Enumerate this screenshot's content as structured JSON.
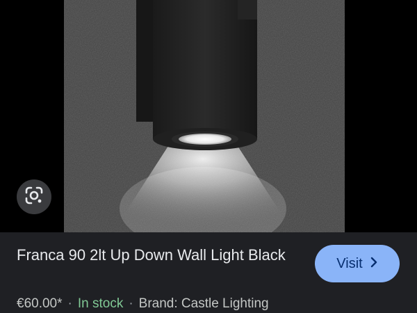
{
  "product": {
    "title": "Franca 90 2lt Up Down Wall Light Black",
    "price": "€60.00*",
    "stock": "In stock",
    "brand": "Brand: Castle Lighting",
    "separator": "·"
  },
  "actions": {
    "visit_label": "Visit"
  },
  "icons": {
    "lens": "google-lens-icon",
    "visit_chevron": "chevron-right-icon"
  },
  "colors": {
    "panel_background": "#1f2024",
    "visit_button": "#8ab4f8",
    "visit_text": "#062e6f",
    "stock_green": "#81c995",
    "title_text": "#e8eaed"
  }
}
